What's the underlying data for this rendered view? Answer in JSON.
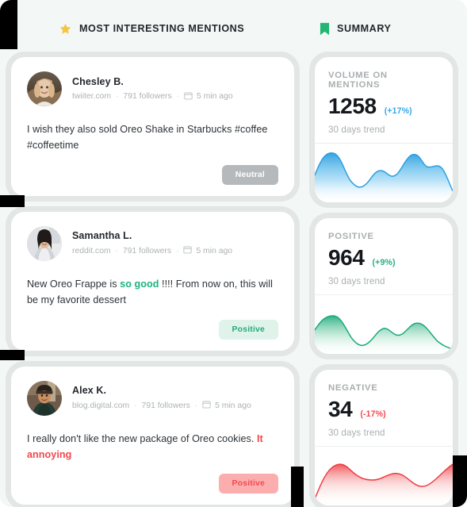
{
  "sections": {
    "mentions": {
      "title": "MOST INTERESTING MENTIONS",
      "icon": "star-icon"
    },
    "summary": {
      "title": "SUMMARY",
      "icon": "bookmark-icon"
    }
  },
  "colors": {
    "star": "#f7c53d",
    "bookmark": "#22b573",
    "blue": "#36a8ea",
    "green": "#25b07f",
    "red": "#f04b4f",
    "page_bg": "#f3f7f6"
  },
  "mentions": [
    {
      "name": "Chesley B.",
      "source": "twiiter.com",
      "followers": "791 followers",
      "time": "5 min ago",
      "text_before": "I wish they also sold Oreo Shake in Starbucks #coffee #coffeetime",
      "highlight": "",
      "text_after": "",
      "badge": "Neutral",
      "badge_kind": "neutral"
    },
    {
      "name": "Samantha L.",
      "source": "reddit.com",
      "followers": "791 followers",
      "time": "5 min ago",
      "text_before": "New Oreo Frappe is ",
      "highlight": "so good",
      "text_after": " !!!! From now on, this will be my favorite dessert",
      "badge": "Positive",
      "badge_kind": "positive"
    },
    {
      "name": "Alex K.",
      "source": "blog.digital.com",
      "followers": "791 followers",
      "time": "5 min ago",
      "text_before": "I really don't like the new package of Oreo cookies. ",
      "highlight": "It annoying",
      "text_after": "",
      "badge": "Positive",
      "badge_kind": "negative"
    }
  ],
  "separator": "·",
  "summary_cards": [
    {
      "label": "VOLUME ON MENTIONS",
      "value": "1258",
      "delta": "(+17%)",
      "trend_label": "30 days trend",
      "color": "#36a8ea"
    },
    {
      "label": "POSITIVE",
      "value": "964",
      "delta": "(+9%)",
      "trend_label": "30 days trend",
      "color": "#25b07f"
    },
    {
      "label": "NEGATIVE",
      "value": "34",
      "delta": "(-17%)",
      "trend_label": "30 days trend",
      "color": "#f04b4f"
    }
  ],
  "chart_data": [
    {
      "type": "area",
      "title": "VOLUME ON MENTIONS",
      "series_name": "30 days trend",
      "color": "#36a8ea",
      "x": [
        0,
        1,
        2,
        3,
        4,
        5,
        6,
        7,
        8,
        9,
        10,
        11,
        12,
        13,
        14,
        15,
        16
      ],
      "values": [
        55,
        74,
        78,
        60,
        32,
        24,
        30,
        46,
        58,
        48,
        50,
        66,
        80,
        70,
        58,
        62,
        18
      ],
      "ylim": [
        0,
        100
      ],
      "grid": false,
      "legend": "none",
      "xlabel": "",
      "ylabel": ""
    },
    {
      "type": "area",
      "title": "POSITIVE",
      "series_name": "30 days trend",
      "color": "#25b07f",
      "x": [
        0,
        1,
        2,
        3,
        4,
        5,
        6,
        7,
        8,
        9,
        10,
        11,
        12,
        13,
        14,
        15,
        16
      ],
      "values": [
        38,
        54,
        58,
        48,
        30,
        16,
        14,
        24,
        40,
        44,
        36,
        30,
        38,
        48,
        44,
        34,
        8
      ],
      "ylim": [
        0,
        100
      ],
      "grid": false,
      "legend": "none",
      "xlabel": "",
      "ylabel": ""
    },
    {
      "type": "area",
      "title": "NEGATIVE",
      "series_name": "30 days trend",
      "color": "#f04b4f",
      "x": [
        0,
        1,
        2,
        3,
        4,
        5,
        6,
        7,
        8,
        9,
        10,
        11,
        12,
        13,
        14,
        15,
        16
      ],
      "values": [
        6,
        34,
        56,
        60,
        52,
        44,
        46,
        46,
        42,
        50,
        52,
        46,
        38,
        34,
        40,
        52,
        60
      ],
      "ylim": [
        0,
        100
      ],
      "grid": false,
      "legend": "none",
      "xlabel": "",
      "ylabel": ""
    }
  ]
}
